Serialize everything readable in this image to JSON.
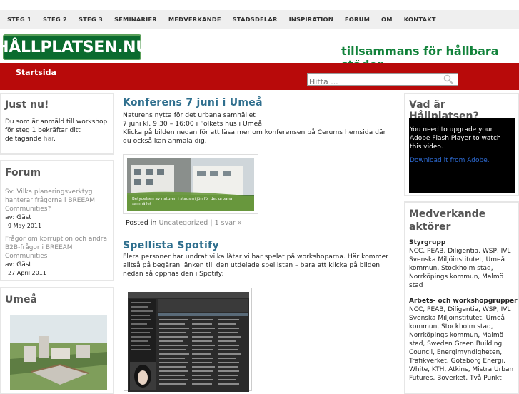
{
  "nav": [
    "STEG 1",
    "STEG 2",
    "STEG 3",
    "SEMINARIER",
    "MEDVERKANDE",
    "STADSDELAR",
    "INSPIRATION",
    "FORUM",
    "OM",
    "KONTAKT"
  ],
  "logo_text": "HÅLLPLATSEN.NU",
  "tagline": "tillsammans för hållbara städer",
  "home_link": "Startsida",
  "search": {
    "placeholder": "Hitta ..."
  },
  "left": {
    "justnu": {
      "title": "Just nu!",
      "text": "Du som är anmäld till workshop för steg 1 bekräftar ditt deltagande",
      "link": "här",
      "end": "."
    },
    "forum": {
      "title": "Forum",
      "posts": [
        {
          "topic": "Sv: Vilka planeringsverktyg hanterar frågorna i BREEAM Communities?",
          "author": "av: Gäst",
          "date": "9 May 2011"
        },
        {
          "topic": "Frågor om korruption och andra B2B-frågor i BREEAM Communities",
          "author": "av: Gäst",
          "date": "27 April 2011"
        }
      ]
    },
    "umea": {
      "title": "Umeå"
    }
  },
  "posts": [
    {
      "title": "Konferens 7 juni i Umeå",
      "lines": [
        "Naturens nytta för det urbana samhället",
        "7 juni kl. 9:30 – 16:00 i Folkets hus i Umeå.",
        "Klicka på bilden nedan för att läsa mer om konferensen på Cerums hemsida där du också kan anmäla dig."
      ],
      "image_caption": "Betydelsen av naturen i stadsmiljön för det urbana samhället",
      "meta_prefix": "Posted in",
      "category": "Uncategorized",
      "separator": "|",
      "replies": "1 svar »"
    },
    {
      "title": "Spellista Spotify",
      "text": "Flera personer har undrat vilka låtar vi har spelat på workshoparna. Här kommer alltså på begäran länken till den utdelade spellistan – bara att klicka på bilden nedan så öppnas den i Spotify:"
    }
  ],
  "right": {
    "vad": {
      "title": "Vad är Hållplatsen?",
      "flash": "You need to upgrade your Adobe Flash Player to watch this video.",
      "flash_link": "Download it from Adobe."
    },
    "medverkande": {
      "title": "Medverkande aktörer",
      "groups": [
        {
          "name": "Styrgrupp",
          "members": "NCC, PEAB, Diligentia, WSP, IVL Svenska Miljöinstitutet, Umeå kommun, Stockholm stad, Norrköpings kommun, Malmö stad"
        },
        {
          "name": "Arbets- och workshopgrupper",
          "members": "NCC, PEAB, Diligentia, WSP, IVL Svenska Miljöinstitutet, Umeå kommun, Stockholm stad, Norrköpings kommun, Malmö stad, Sweden Green Building Council, Energimyndigheten, Trafikverket, Göteborg Energi, White, KTH, Atkins, Mistra Urban Futures, Boverket, Två Punkt"
        }
      ]
    }
  }
}
